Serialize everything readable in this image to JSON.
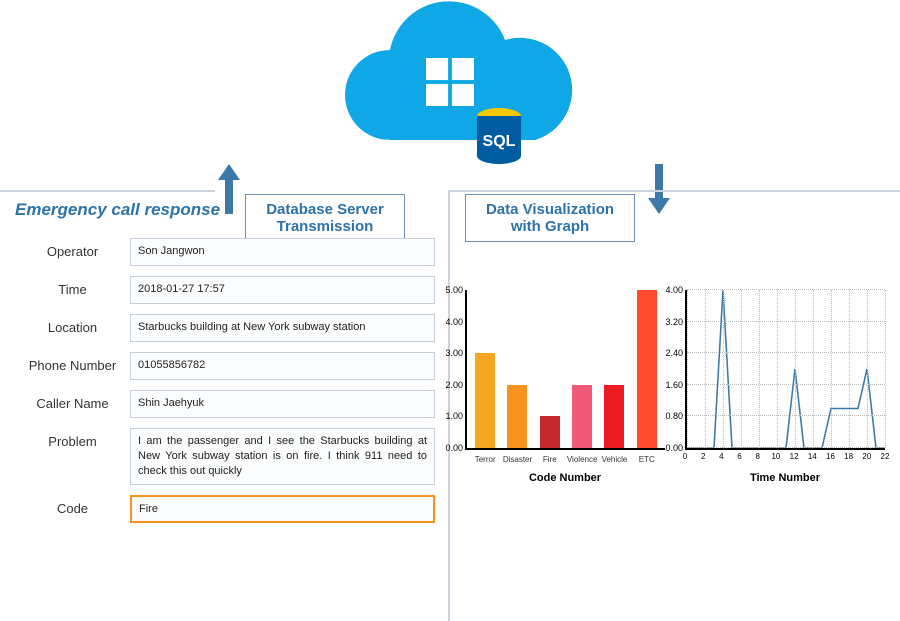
{
  "cloud": {
    "brand": "Azure",
    "db_label": "SQL"
  },
  "labels": {
    "left_line1": "Database Server",
    "left_line2": "Transmission",
    "right_line1": "Data Visualization",
    "right_line2": "with Graph"
  },
  "form": {
    "title": "Emergency call response",
    "fields": {
      "operator_label": "Operator",
      "operator_value": "Son Jangwon",
      "time_label": "Time",
      "time_value": "2018-01-27  17:57",
      "location_label": "Location",
      "location_value": "Starbucks building at New York subway station",
      "phone_label": "Phone Number",
      "phone_value": "01055856782",
      "caller_label": "Caller Name",
      "caller_value": "Shin Jaehyuk",
      "problem_label": "Problem",
      "problem_value": "I am the passenger and I see the Starbucks building at New York subway station is on fire. I think 911 need to check this out quickly",
      "code_label": "Code",
      "code_value": "Fire"
    }
  },
  "chart_data": [
    {
      "type": "bar",
      "title": "Code Number",
      "ylim": [
        0,
        5
      ],
      "y_ticks": [
        0.0,
        1.0,
        2.0,
        3.0,
        4.0,
        5.0
      ],
      "categories": [
        "Terror",
        "Disaster",
        "Fire",
        "Violence",
        "Vehicle",
        "ETC"
      ],
      "values": [
        3,
        2,
        1,
        2,
        2,
        5
      ],
      "colors": [
        "#f5a623",
        "#f7941e",
        "#c1272d",
        "#f05a78",
        "#ed1c24",
        "#ff4c2f"
      ]
    },
    {
      "type": "line",
      "title": "Time Number",
      "xlim": [
        0,
        22
      ],
      "ylim": [
        0,
        4
      ],
      "x_ticks": [
        0,
        2,
        4,
        6,
        8,
        10,
        12,
        14,
        16,
        18,
        20,
        22
      ],
      "y_ticks": [
        0.0,
        0.8,
        1.6,
        2.4,
        3.2,
        4.0
      ],
      "series": [
        {
          "name": "count",
          "x": [
            0,
            1,
            2,
            3,
            4,
            5,
            6,
            7,
            8,
            9,
            10,
            11,
            12,
            13,
            14,
            15,
            16,
            17,
            18,
            19,
            20,
            21,
            22
          ],
          "values": [
            0,
            0,
            0,
            0,
            4,
            0,
            0,
            0,
            0,
            0,
            0,
            0,
            2,
            0,
            0,
            0,
            1,
            1,
            1,
            1,
            2,
            0,
            0
          ]
        }
      ]
    }
  ]
}
